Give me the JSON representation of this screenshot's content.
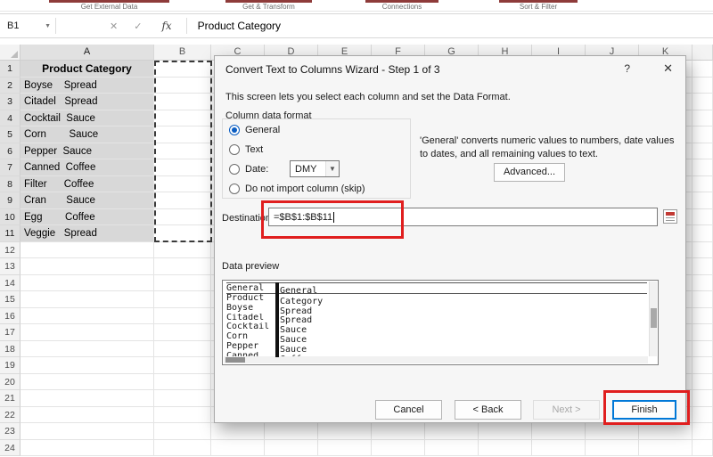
{
  "ribbon": {
    "groups": [
      {
        "label": "Get External Data"
      },
      {
        "label": "Get & Transform"
      },
      {
        "label": "Connections"
      },
      {
        "label": "Sort & Filter"
      }
    ]
  },
  "formula_bar": {
    "name_box": "B1",
    "cancel_icon": "✕",
    "enter_icon": "✓",
    "fx_icon": "fx",
    "formula": "Product Category"
  },
  "spreadsheet": {
    "columns": [
      "A",
      "B",
      "C",
      "D",
      "E",
      "F",
      "G",
      "H",
      "I",
      "J",
      "K"
    ],
    "row_count": 24,
    "selected_range_rows": 11,
    "column_a_cells": [
      "Product Category",
      "Boyse    Spread",
      "Citadel   Spread",
      "Cocktail  Sauce",
      "Corn        Sauce",
      "Pepper  Sauce",
      "Canned  Coffee",
      "Filter      Coffee",
      "Cran       Sauce",
      "Egg        Coffee",
      "Veggie   Spread"
    ]
  },
  "dialog": {
    "title": "Convert Text to Columns Wizard - Step 1 of 3",
    "help_icon": "?",
    "close_icon": "✕",
    "description": "This screen lets you select each column and set the Data Format.",
    "format_group_label": "Column data format",
    "radio_options": [
      {
        "label": "General",
        "selected": true
      },
      {
        "label": "Text",
        "selected": false
      },
      {
        "label": "Date:",
        "selected": false
      },
      {
        "label": "Do not import column (skip)",
        "selected": false
      }
    ],
    "date_format_value": "DMY",
    "general_note": "'General' converts numeric values to numbers, date values to dates, and all remaining values to text.",
    "advanced_button": "Advanced...",
    "destination_label": "Destination:",
    "destination_value": "=$B$1:$B$11",
    "data_preview_label": "Data preview",
    "preview_headers": [
      "General",
      "General"
    ],
    "preview_rows": [
      [
        "Product",
        "Category"
      ],
      [
        "Boyse",
        "Spread"
      ],
      [
        "Citadel",
        "Spread"
      ],
      [
        "Cocktail",
        "Sauce"
      ],
      [
        "Corn",
        "Sauce"
      ],
      [
        "Pepper",
        "Sauce"
      ],
      [
        "Canned",
        "Coffee"
      ]
    ],
    "buttons": {
      "cancel": "Cancel",
      "back": "< Back",
      "next": "Next >",
      "finish": "Finish"
    }
  }
}
